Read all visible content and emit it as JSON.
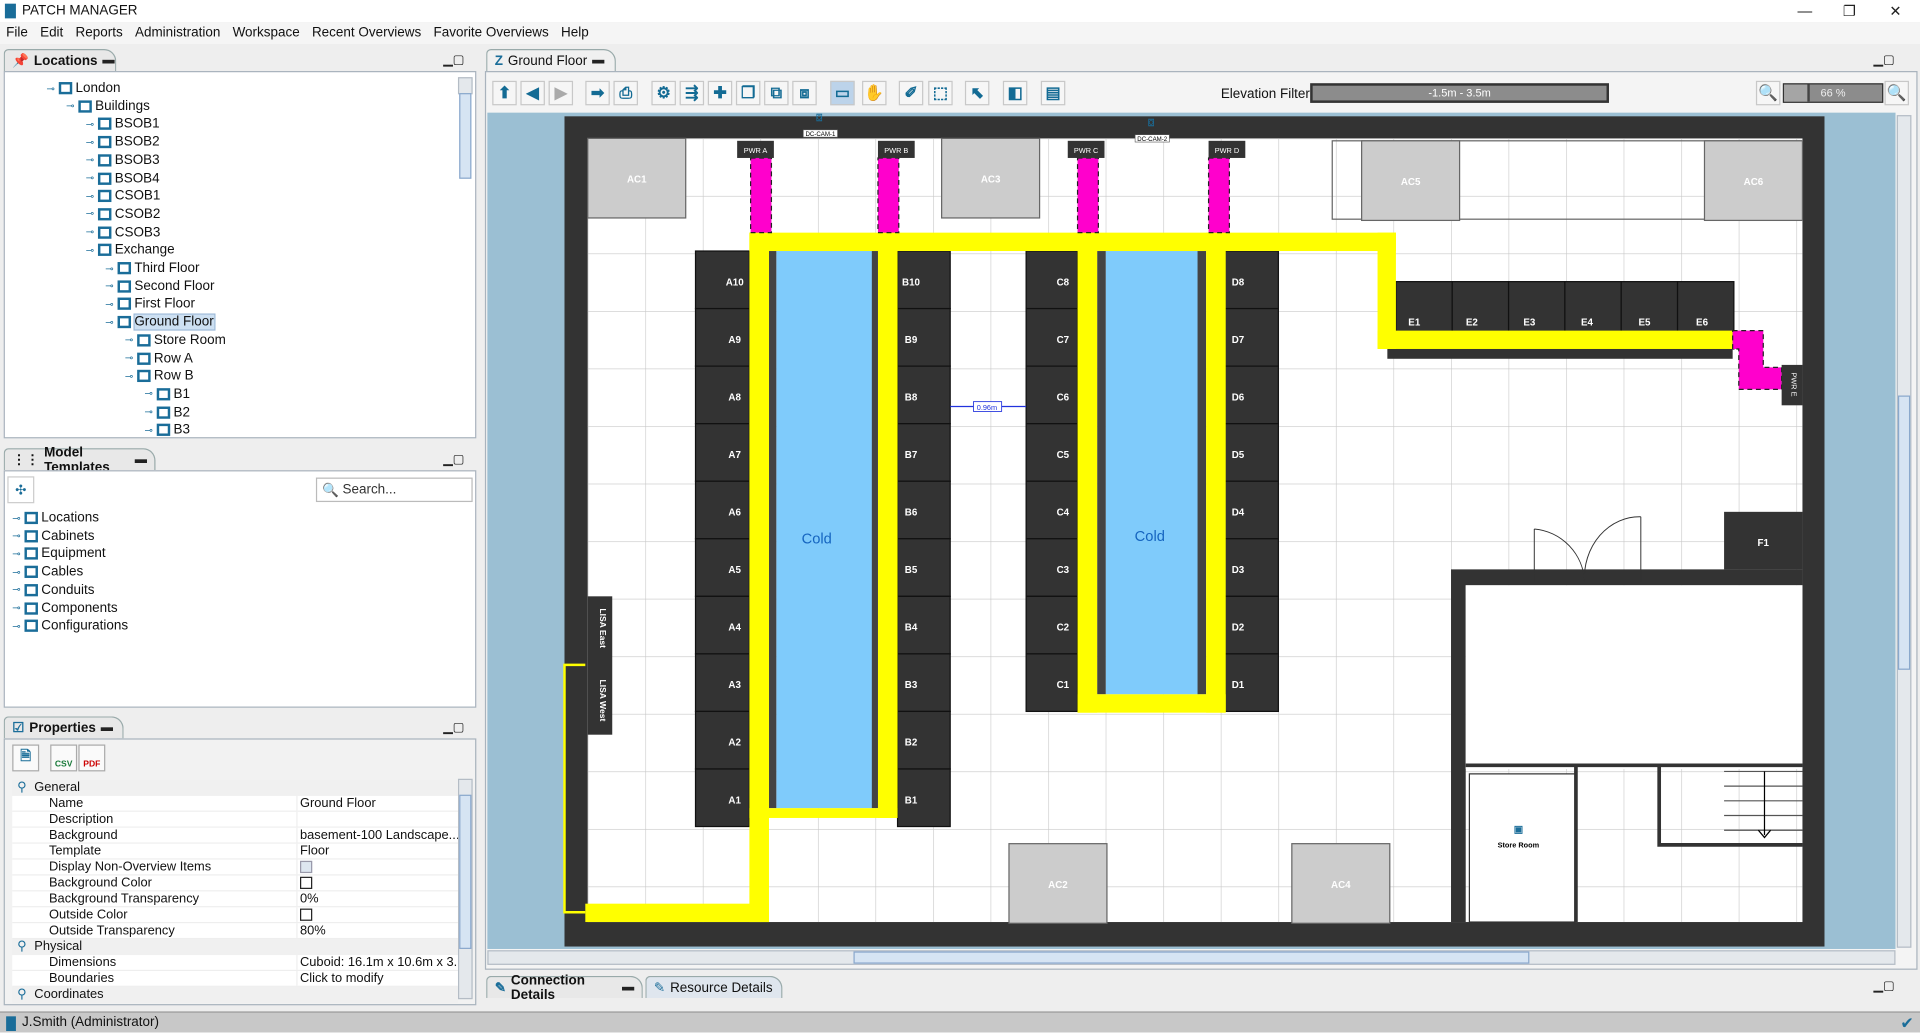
{
  "app": {
    "title": "PATCH MANAGER",
    "user": "J.Smith (Administrator)"
  },
  "menu": [
    "File",
    "Edit",
    "Reports",
    "Administration",
    "Workspace",
    "Recent Overviews",
    "Favorite Overviews",
    "Help"
  ],
  "locations": {
    "title": "Locations",
    "items": [
      {
        "label": "London",
        "level": 0
      },
      {
        "label": "Buildings",
        "level": 1
      },
      {
        "label": "BSOB1",
        "level": 2
      },
      {
        "label": "BSOB2",
        "level": 2
      },
      {
        "label": "BSOB3",
        "level": 2
      },
      {
        "label": "BSOB4",
        "level": 2
      },
      {
        "label": "CSOB1",
        "level": 2
      },
      {
        "label": "CSOB2",
        "level": 2
      },
      {
        "label": "CSOB3",
        "level": 2
      },
      {
        "label": "Exchange",
        "level": 2
      },
      {
        "label": "Third Floor",
        "level": 3
      },
      {
        "label": "Second Floor",
        "level": 3
      },
      {
        "label": "First Floor",
        "level": 3
      },
      {
        "label": "Ground Floor",
        "level": 3,
        "selected": true
      },
      {
        "label": "Store Room",
        "level": 4
      },
      {
        "label": "Row A",
        "level": 4
      },
      {
        "label": "Row B",
        "level": 4
      },
      {
        "label": "B1",
        "level": 5
      },
      {
        "label": "B2",
        "level": 5
      },
      {
        "label": "B3",
        "level": 5
      }
    ]
  },
  "templates": {
    "title": "Model Templates",
    "search_placeholder": "Search...",
    "items": [
      "Locations",
      "Cabinets",
      "Equipment",
      "Cables",
      "Conduits",
      "Components",
      "Configurations"
    ]
  },
  "properties": {
    "title": "Properties",
    "groups": [
      {
        "name": "General",
        "rows": [
          [
            "Name",
            "Ground Floor"
          ],
          [
            "Description",
            ""
          ],
          [
            "Background",
            "basement-100 Landscape...."
          ],
          [
            "Template",
            "Floor"
          ],
          [
            "Display Non-Overview Items",
            "[checkbox]"
          ],
          [
            "Background Color",
            "[color]"
          ],
          [
            "Background Transparency",
            "0%"
          ],
          [
            "Outside Color",
            "[color]"
          ],
          [
            "Outside Transparency",
            "80%"
          ]
        ]
      },
      {
        "name": "Physical",
        "rows": [
          [
            "Dimensions",
            "Cuboid: 16.1m x 10.6m x 3...."
          ],
          [
            "Boundaries",
            "Click to modify"
          ]
        ]
      },
      {
        "name": "Coordinates",
        "rows": []
      }
    ]
  },
  "editor": {
    "tab": "Ground Floor",
    "elevation_label": "Elevation Filter:",
    "elevation_value": "-1.5m - 3.5m",
    "zoom": "66 %",
    "zoom_percent": 66
  },
  "bottom_tabs": [
    "Connection Details",
    "Resource Details"
  ],
  "floor": {
    "rows": {
      "A": [
        "A10",
        "A9",
        "A8",
        "A7",
        "A6",
        "A5",
        "A4",
        "A3",
        "A2",
        "A1"
      ],
      "B": [
        "B10",
        "B9",
        "B8",
        "B7",
        "B6",
        "B5",
        "B4",
        "B3",
        "B2",
        "B1"
      ],
      "C": [
        "C8",
        "C7",
        "C6",
        "C5",
        "C4",
        "C3",
        "C2",
        "C1"
      ],
      "D": [
        "D8",
        "D7",
        "D6",
        "D5",
        "D4",
        "D3",
        "D2",
        "D1"
      ],
      "E": [
        "E1",
        "E2",
        "E3",
        "E4",
        "E5",
        "E6"
      ]
    },
    "ac": [
      "AC1",
      "AC3",
      "AC5",
      "AC6",
      "AC2",
      "AC4"
    ],
    "pwr": [
      "PWR A",
      "PWR B",
      "PWR C",
      "PWR D",
      "PWR E"
    ],
    "cams": [
      "DC-CAM-1",
      "DC-CAM-2"
    ],
    "cold": "Cold",
    "f1": "F1",
    "store_room": "Store Room",
    "lisa_east": "LISA East",
    "lisa_west": "LISA West",
    "measure": "0.96m",
    "colors": {
      "cable_tray": "#ffff00",
      "power": "#ff00cc",
      "cold_aisle": "#7fcbfb",
      "rack": "#333333"
    }
  }
}
